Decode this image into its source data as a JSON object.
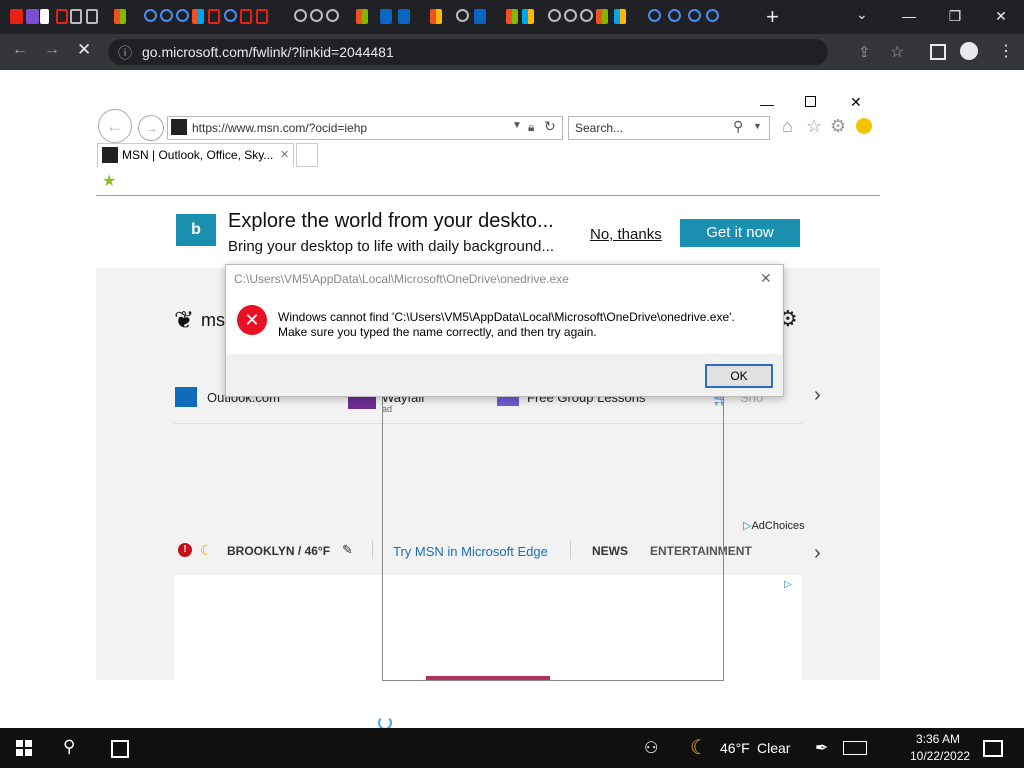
{
  "chrome": {
    "new_tab_label": "+",
    "url": "go.microsoft.com/fwlink/?linkid=2044481",
    "window_controls": {
      "minimize": "—",
      "restore": "❐",
      "close": "✕"
    }
  },
  "ie": {
    "address": "https://www.msn.com/?ocid=iehp",
    "search_placeholder": "Search...",
    "tab_title": "MSN | Outlook, Office, Sky...",
    "tab_close": "✕"
  },
  "banner": {
    "title": "Explore the world from your deskto...",
    "subtitle": "Bring your desktop to life with daily background...",
    "no_thanks": "No, thanks",
    "get_it_now": "Get it now"
  },
  "msn": {
    "logo_text": "ms",
    "quicklinks": [
      {
        "label": "Outlook.com",
        "sub": ""
      },
      {
        "label": "Wayfair",
        "sub": "ad"
      },
      {
        "label": "Free Group Lessons",
        "sub": ""
      },
      {
        "label": "Sho",
        "sub": ""
      }
    ],
    "adchoices": "AdChoices",
    "weather": "BROOKLYN / 46°F",
    "try_edge": "Try MSN in Microsoft Edge",
    "nav_items": [
      "NEWS",
      "ENTERTAINMENT"
    ]
  },
  "dialog": {
    "title": "C:\\Users\\VM5\\AppData\\Local\\Microsoft\\OneDrive\\onedrive.exe",
    "message_line1": "Windows cannot find 'C:\\Users\\VM5\\AppData\\Local\\Microsoft\\OneDrive\\onedrive.exe'.",
    "message_line2": "Make sure you typed the name correctly, and then try again.",
    "ok_label": "OK"
  },
  "taskbar": {
    "temperature": "46°F",
    "condition": "Clear",
    "time": "3:36 AM",
    "date": "10/22/2022"
  },
  "colors": {
    "chrome_dark": "#202124",
    "bing_teal": "#1a8fb0",
    "error_red": "#e81123",
    "link_blue": "#1a6fb3"
  }
}
